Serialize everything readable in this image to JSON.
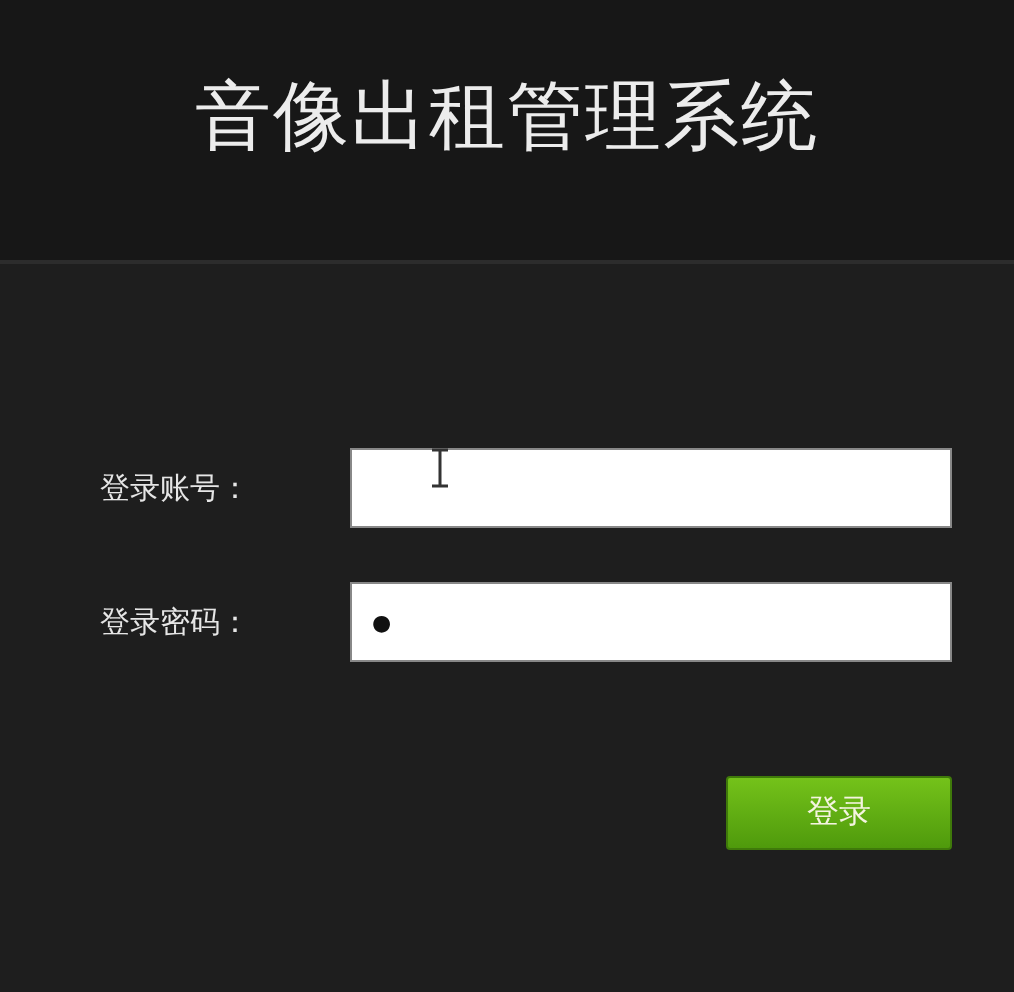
{
  "header": {
    "title": "音像出租管理系统"
  },
  "fields": [
    {
      "label": "登录账号："
    },
    {
      "label": "登录密码：",
      "value": "●"
    }
  ],
  "login_button": {
    "label": "登录"
  }
}
